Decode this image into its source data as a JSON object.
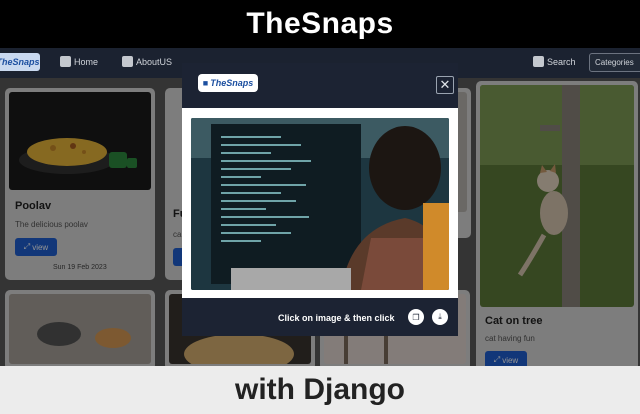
{
  "banner": {
    "top_text": "TheSnaps",
    "bottom_text": "with Django"
  },
  "navbar": {
    "logo_text": "TheSnaps",
    "home_label": "Home",
    "about_label": "AboutUS",
    "search_label": "Search",
    "categories_label": "Categories"
  },
  "cards": [
    {
      "title": "Poolav",
      "description": "The delicious poolav",
      "button_label": "view",
      "date": "Sun 19 Feb 2023"
    },
    {
      "title": "Fu",
      "description": "ca",
      "button_label": "view"
    },
    {
      "title": "Cat on tree",
      "description": "cat having fun",
      "button_label": "view"
    }
  ],
  "modal": {
    "logo_text": "TheSnaps",
    "close_symbol": "✕",
    "footer_text": "Click on image & then click"
  },
  "colors": {
    "navbar": "#1b2230",
    "modal": "#1c2333",
    "accent": "#1f5fd1"
  },
  "icons": [
    "home-icon",
    "about-icon",
    "search-icon",
    "camera-icon",
    "copy-icon",
    "download-icon",
    "close-icon"
  ]
}
